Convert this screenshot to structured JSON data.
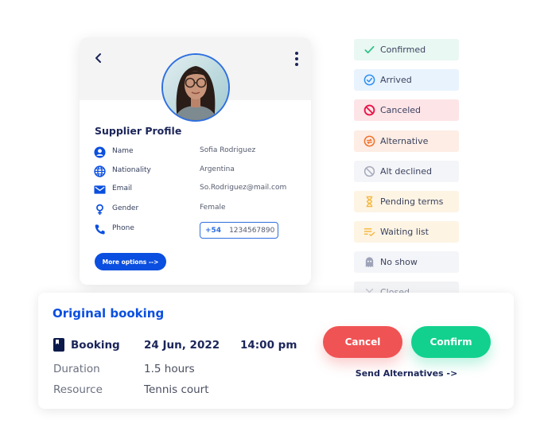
{
  "profile": {
    "title": "Supplier Profile",
    "back_icon": "chevron-left-icon",
    "menu_icon": "kebab-menu-icon",
    "avatar": "profile-photo",
    "fields": [
      {
        "icon": "user-icon",
        "label": "Name",
        "value": "Sofia Rodriguez"
      },
      {
        "icon": "globe-icon",
        "label": "Nationality",
        "value": "Argentina"
      },
      {
        "icon": "mail-icon",
        "label": "Email",
        "value": "So.Rodriguez@mail.com"
      },
      {
        "icon": "female-icon",
        "label": "Gender",
        "value": "Female"
      },
      {
        "icon": "phone-icon",
        "label": "Phone",
        "value": ""
      }
    ],
    "phone": {
      "country_code": "+54",
      "number": "1234567890"
    },
    "more_options_label": "More options -->",
    "accent": "#0b4fe0"
  },
  "statuses": [
    {
      "label": "Confirmed",
      "icon": "check-icon",
      "bg": "#e9f8f2",
      "color": "#2cc28a"
    },
    {
      "label": "Arrived",
      "icon": "check-circle-icon",
      "bg": "#e8f3fd",
      "color": "#2d8ef0"
    },
    {
      "label": "Canceled",
      "icon": "prohibited-icon",
      "bg": "#fde4e7",
      "color": "#e8174a"
    },
    {
      "label": "Alternative",
      "icon": "swap-circle-icon",
      "bg": "#fdede4",
      "color": "#f0702a"
    },
    {
      "label": "Alt declined",
      "icon": "declined-icon",
      "bg": "#f4f5f8",
      "color": "#a6aabb"
    },
    {
      "label": "Pending terms",
      "icon": "hourglass-icon",
      "bg": "#fdf4e4",
      "color": "#f5b63c"
    },
    {
      "label": "Waiting list",
      "icon": "waitlist-icon",
      "bg": "#fdf4e4",
      "color": "#f5b63c"
    },
    {
      "label": "No show",
      "icon": "ghost-icon",
      "bg": "#f4f5f8",
      "color": "#9ea3b8"
    },
    {
      "label": "Closed",
      "icon": "close-icon",
      "bg": "#eeeff2",
      "color": "#9ea3b8"
    }
  ],
  "booking": {
    "title": "Original booking",
    "type_label": "Booking",
    "type_icon": "bookmark-book-icon",
    "date": "24 Jun, 2022",
    "time": "14:00 pm",
    "duration_label": "Duration",
    "duration_value": "1.5 hours",
    "resource_label": "Resource",
    "resource_value": "Tennis court",
    "cancel_label": "Cancel",
    "confirm_label": "Confirm",
    "send_alternatives_label": "Send Alternatives ->",
    "cancel_color": "#f05354",
    "confirm_color": "#12d18e"
  }
}
